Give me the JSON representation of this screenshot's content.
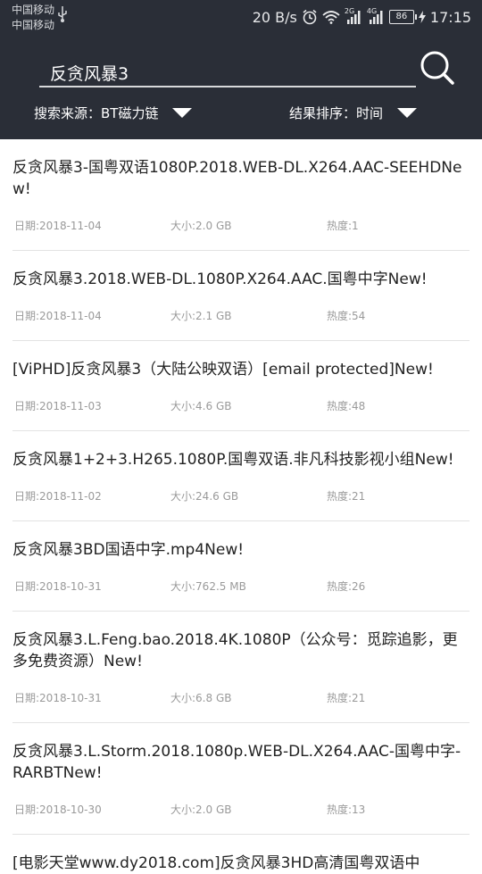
{
  "status_bar": {
    "carrier_1": "中国移动",
    "carrier_2": "中国移动",
    "speed": "20 B/s",
    "net_1": "2G",
    "net_2": "4G",
    "battery": "86",
    "time": "17:15"
  },
  "search": {
    "query": "反贪风暴3"
  },
  "filters": {
    "source_label": "搜索来源：BT磁力链",
    "sort_label": "结果排序：时间"
  },
  "results": [
    {
      "title": "反贪风暴3-国粤双语1080P.2018.WEB-DL.X264.AAC-SEEHDNew!",
      "date": "日期:2018-11-04",
      "size": "大小:2.0 GB",
      "heat": "热度:1"
    },
    {
      "title": "反贪风暴3.2018.WEB-DL.1080P.X264.AAC.国粤中字New!",
      "date": "日期:2018-11-04",
      "size": "大小:2.1 GB",
      "heat": "热度:54"
    },
    {
      "title": "[ViPHD]反贪风暴3（大陆公映双语）[email protected]New!",
      "date": "日期:2018-11-03",
      "size": "大小:4.6 GB",
      "heat": "热度:48"
    },
    {
      "title": "反贪风暴1+2+3.H265.1080P.国粤双语.非凡科技影视小组New!",
      "date": "日期:2018-11-02",
      "size": "大小:24.6 GB",
      "heat": "热度:21"
    },
    {
      "title": "反贪风暴3BD国语中字.mp4New!",
      "date": "日期:2018-10-31",
      "size": "大小:762.5 MB",
      "heat": "热度:26"
    },
    {
      "title": "反贪风暴3.L.Feng.bao.2018.4K.1080P（公众号：觅踪追影，更多免费资源）New!",
      "date": "日期:2018-10-31",
      "size": "大小:6.8 GB",
      "heat": "热度:21"
    },
    {
      "title": "反贪风暴3.L.Storm.2018.1080p.WEB-DL.X264.AAC-国粤中字-RARBTNew!",
      "date": "日期:2018-10-30",
      "size": "大小:2.0 GB",
      "heat": "热度:13"
    },
    {
      "title": "[电影天堂www.dy2018.com]反贪风暴3HD高清国粤双语中",
      "date": "",
      "size": "",
      "heat": ""
    }
  ]
}
